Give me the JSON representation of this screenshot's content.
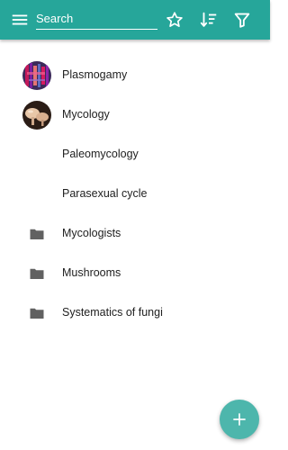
{
  "appbar": {
    "menu_icon": "menu-icon",
    "search": {
      "placeholder": "Search",
      "value": ""
    },
    "actions": [
      "star-icon",
      "sort-icon",
      "filter-icon"
    ],
    "color": "#26a69a"
  },
  "items": [
    {
      "label": "Plasmogamy",
      "lead": "avatar"
    },
    {
      "label": "Mycology",
      "lead": "avatar"
    },
    {
      "label": "Paleomycology",
      "lead": "none"
    },
    {
      "label": "Parasexual cycle",
      "lead": "none"
    },
    {
      "label": "Mycologists",
      "lead": "folder-icon"
    },
    {
      "label": "Mushrooms",
      "lead": "folder-icon"
    },
    {
      "label": "Systematics of fungi",
      "lead": "folder-icon"
    }
  ],
  "fab": {
    "icon": "plus-icon",
    "color": "#4db6ac"
  }
}
